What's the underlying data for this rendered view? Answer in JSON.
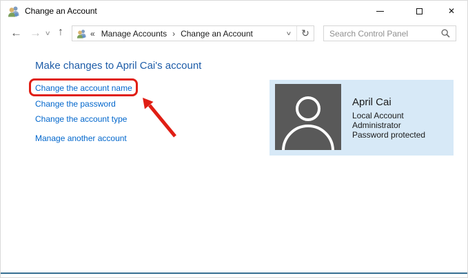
{
  "titlebar": {
    "title": "Change an Account",
    "close_icon": "✕"
  },
  "navbar": {
    "back_icon": "←",
    "forward_icon": "→",
    "history_dropdown_icon": "∨",
    "up_icon": "↑",
    "address_dropdown_icon": "∨",
    "refresh_icon": "↻",
    "breadcrumb": {
      "overflow_icon": "«",
      "separator_icon": "›",
      "items": [
        "Manage Accounts",
        "Change an Account"
      ]
    },
    "search": {
      "placeholder": "Search Control Panel",
      "icon": "magnifier"
    }
  },
  "main": {
    "heading": "Make changes to April Cai's account",
    "task_links": [
      "Change the account name",
      "Change the password",
      "Change the account type"
    ],
    "manage_link": "Manage another account"
  },
  "account_tile": {
    "name": "April Cai",
    "details": [
      "Local Account",
      "Administrator",
      "Password protected"
    ]
  },
  "annotations": {
    "highlighted_link": "Change the account name",
    "shapes": [
      "red-rounded-box",
      "red-arrow"
    ]
  },
  "colors": {
    "heading_blue": "#1d5ca8",
    "link_blue": "#0066cc",
    "annotation_red": "#e01e14",
    "tile_background": "#d7e9f7",
    "avatar_gray": "#595959",
    "window_bottom_accent": "#376f91"
  }
}
